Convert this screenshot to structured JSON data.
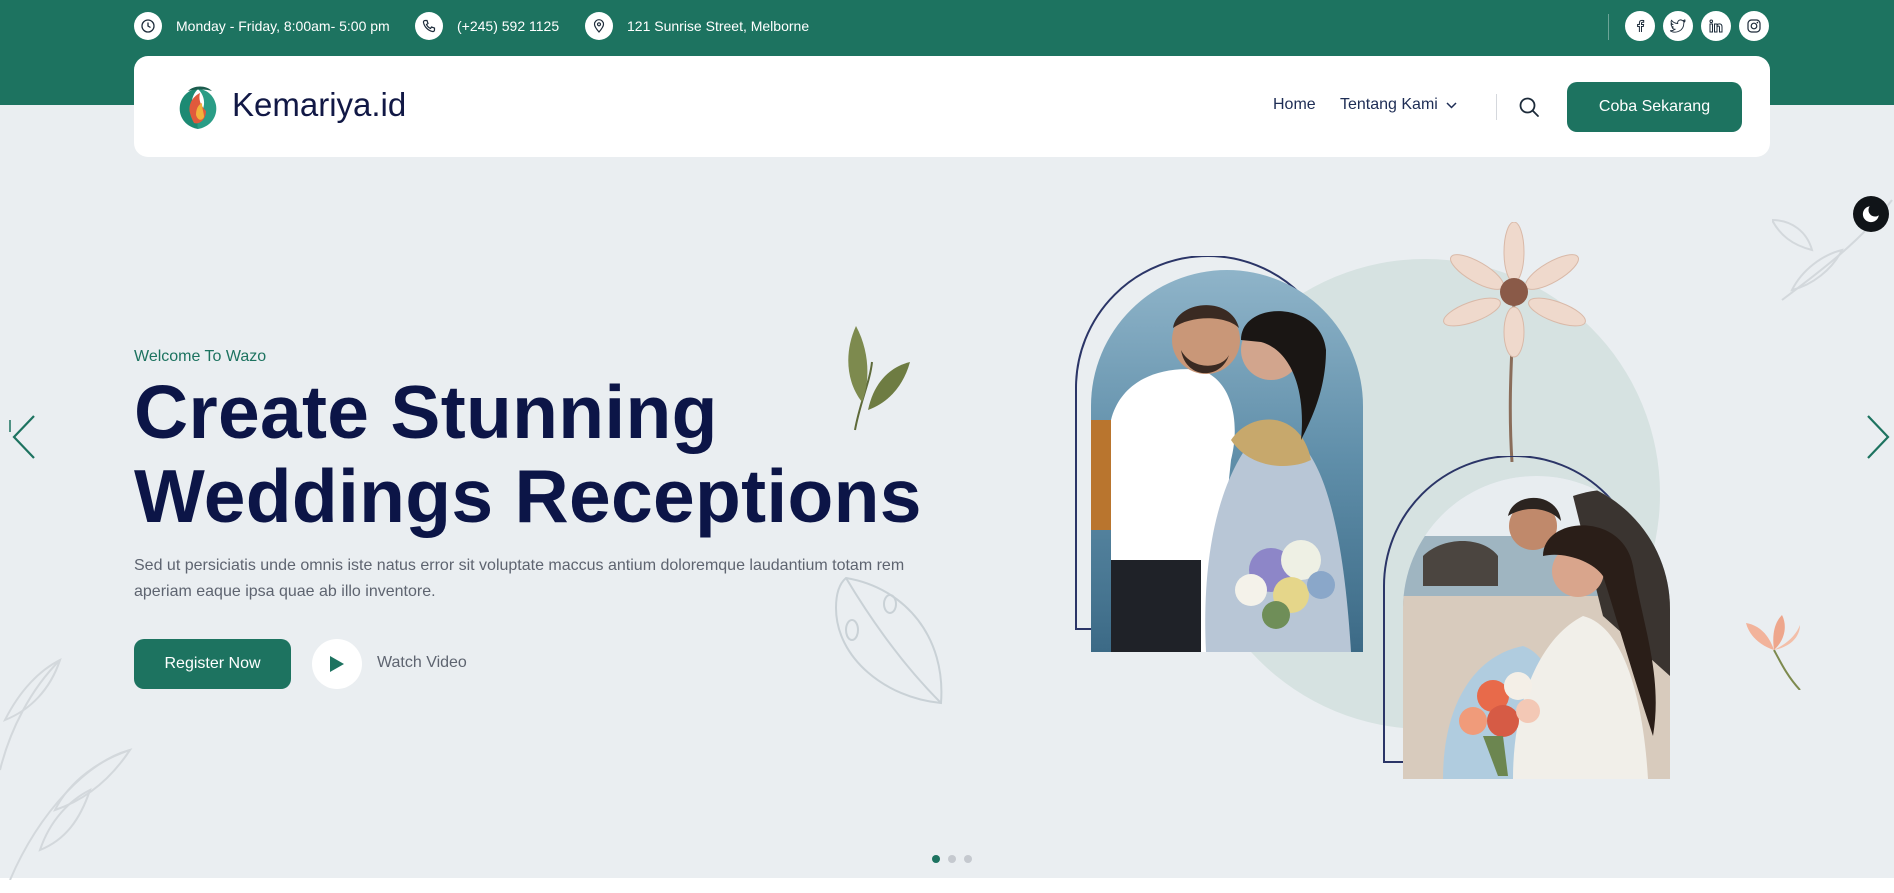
{
  "topbar": {
    "hours": "Monday - Friday, 8:00am- 5:00 pm",
    "phone": "(+245) 592 1125",
    "address": "121 Sunrise Street, Melborne",
    "socials": [
      "facebook-icon",
      "twitter-icon",
      "linkedin-icon",
      "instagram-icon"
    ]
  },
  "nav": {
    "logo_text": "Kemariya.id",
    "links": [
      "Home",
      "Tentang Kami"
    ],
    "cta_label": "Coba Sekarang"
  },
  "hero": {
    "eyebrow": "Welcome To Wazo",
    "title_line1": "Create Stunning",
    "title_line2": "Weddings Receptions",
    "description": "Sed ut persiciatis unde omnis iste natus error sit voluptate maccus antium doloremque laudantium totam rem aperiam eaque ipsa quae ab illo inventore.",
    "register_label": "Register Now",
    "watch_label": "Watch Video"
  },
  "slider": {
    "slide_count": 3,
    "active_index": 0
  },
  "colors": {
    "brand": "#1d7360",
    "headline": "#0c1547",
    "background": "#eaeef1"
  }
}
